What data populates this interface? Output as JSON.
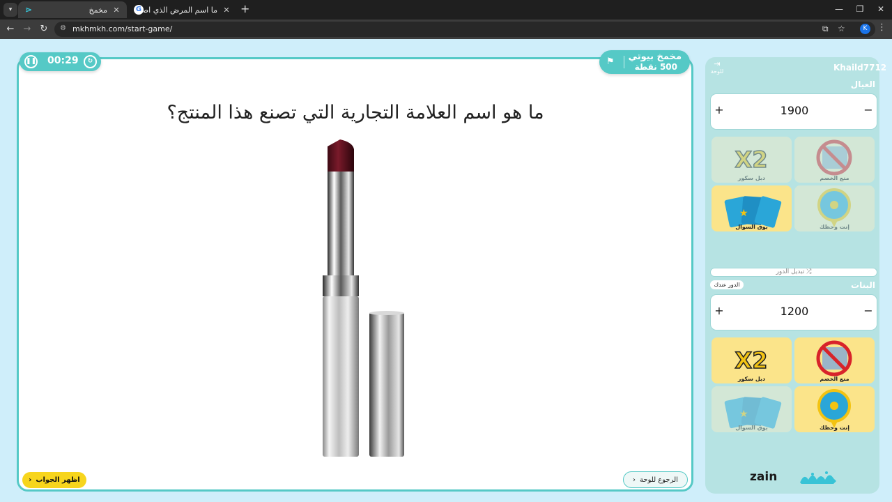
{
  "browser": {
    "tabs": [
      {
        "title": "مخمخ",
        "active": true
      },
      {
        "title": "ما اسم المرض الذي اصاب جورا...",
        "active": false
      }
    ],
    "url": "mkhmkh.com/start-game/",
    "profile_initial": "K"
  },
  "game": {
    "timer": "00:29",
    "category": {
      "name": "مخمخ بيوتي",
      "points": "500 نقطة"
    },
    "question": "ما هو اسم العلامة التجارية التي تصنع هذا المنتج؟",
    "show_answer_label": "اظهر الجواب",
    "back_to_board_label": "الرجوع للوحة"
  },
  "panel": {
    "player": "Khaild7712",
    "board_link": "للوحة",
    "switch_turn_label": "تبديل الدور",
    "turn_badge": "الدور عندك",
    "teams": [
      {
        "name": "العيال",
        "score": "1900",
        "aids": [
          {
            "label": "منع الخصم",
            "used": true
          },
          {
            "label": "دبل سكور",
            "used": true
          },
          {
            "label": "إنت وحظك",
            "used": true
          },
          {
            "label": "بوق السوال",
            "used": false
          }
        ]
      },
      {
        "name": "البنات",
        "score": "1200",
        "aids": [
          {
            "label": "منع الخصم",
            "used": false
          },
          {
            "label": "دبل سكور",
            "used": false
          },
          {
            "label": "إنت وحظك",
            "used": false
          },
          {
            "label": "بوق السوال",
            "used": true
          }
        ]
      }
    ]
  },
  "branding": {
    "sponsor": "zain"
  },
  "colors": {
    "accent": "#55c9c6",
    "panel": "#b6e3e3",
    "answer_button": "#f7d51d",
    "page_bg": "#cfeefa"
  },
  "icons": [
    "pause-icon",
    "reset-icon",
    "flag-icon",
    "exit-icon",
    "shuffle-icon",
    "lipstick-image"
  ]
}
